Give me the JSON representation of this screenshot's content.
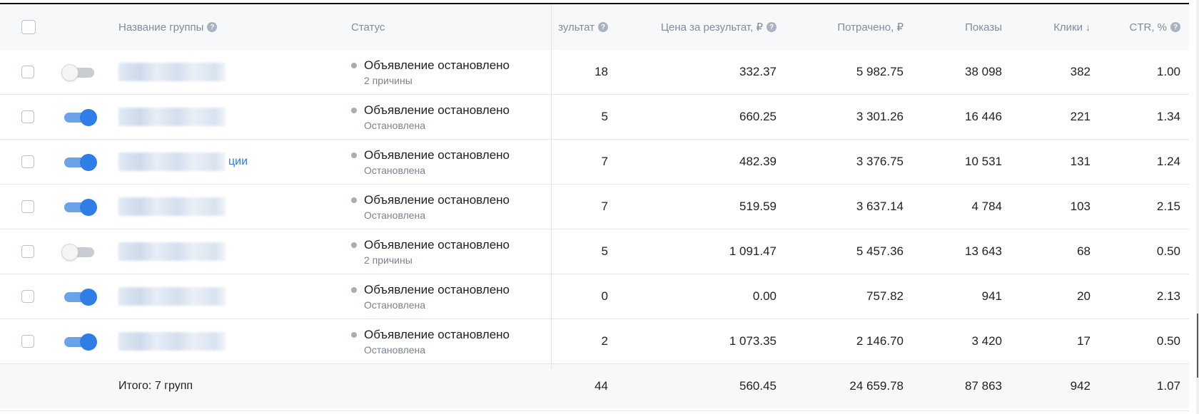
{
  "header": {
    "name_label": "Название группы",
    "status_label": "Статус",
    "result_label": "зультат",
    "price_label": "Цена за результат, ₽",
    "spent_label": "Потрачено, ₽",
    "shows_label": "Показы",
    "clicks_label": "Клики",
    "clicks_sort_icon": "arrow-down-icon",
    "ctr_label": "CTR, %"
  },
  "rows": [
    {
      "toggle": "off",
      "name_suffix": "",
      "status": "Объявление остановлено",
      "status_sub": "2 причины",
      "result": "18",
      "price": "332.37",
      "spent": "5 982.75",
      "shows": "38 098",
      "clicks": "382",
      "ctr": "1.00"
    },
    {
      "toggle": "on",
      "name_suffix": "",
      "status": "Объявление остановлено",
      "status_sub": "Остановлена",
      "result": "5",
      "price": "660.25",
      "spent": "3 301.26",
      "shows": "16 446",
      "clicks": "221",
      "ctr": "1.34"
    },
    {
      "toggle": "on",
      "name_suffix": "ции",
      "status": "Объявление остановлено",
      "status_sub": "Остановлена",
      "result": "7",
      "price": "482.39",
      "spent": "3 376.75",
      "shows": "10 531",
      "clicks": "131",
      "ctr": "1.24"
    },
    {
      "toggle": "on",
      "name_suffix": "",
      "status": "Объявление остановлено",
      "status_sub": "Остановлена",
      "result": "7",
      "price": "519.59",
      "spent": "3 637.14",
      "shows": "4 784",
      "clicks": "103",
      "ctr": "2.15"
    },
    {
      "toggle": "off",
      "name_suffix": "",
      "status": "Объявление остановлено",
      "status_sub": "2 причины",
      "result": "5",
      "price": "1 091.47",
      "spent": "5 457.36",
      "shows": "13 643",
      "clicks": "68",
      "ctr": "0.50"
    },
    {
      "toggle": "on",
      "name_suffix": "",
      "status": "Объявление остановлено",
      "status_sub": "Остановлена",
      "result": "0",
      "price": "0.00",
      "spent": "757.82",
      "shows": "941",
      "clicks": "20",
      "ctr": "2.13"
    },
    {
      "toggle": "on",
      "name_suffix": "",
      "status": "Объявление остановлено",
      "status_sub": "Остановлена",
      "result": "2",
      "price": "1 073.35",
      "spent": "2 146.70",
      "shows": "3 420",
      "clicks": "17",
      "ctr": "0.50"
    }
  ],
  "total": {
    "label": "Итого: 7 групп",
    "result": "44",
    "price": "560.45",
    "spent": "24 659.78",
    "shows": "87 863",
    "clicks": "942",
    "ctr": "1.07"
  },
  "colors": {
    "accent": "#2f7ee8",
    "toggle_on_track": "#6aa3e8",
    "header_bg": "#f7f8fa",
    "muted_text": "#818c99",
    "status_dot": "#a7adb5"
  }
}
